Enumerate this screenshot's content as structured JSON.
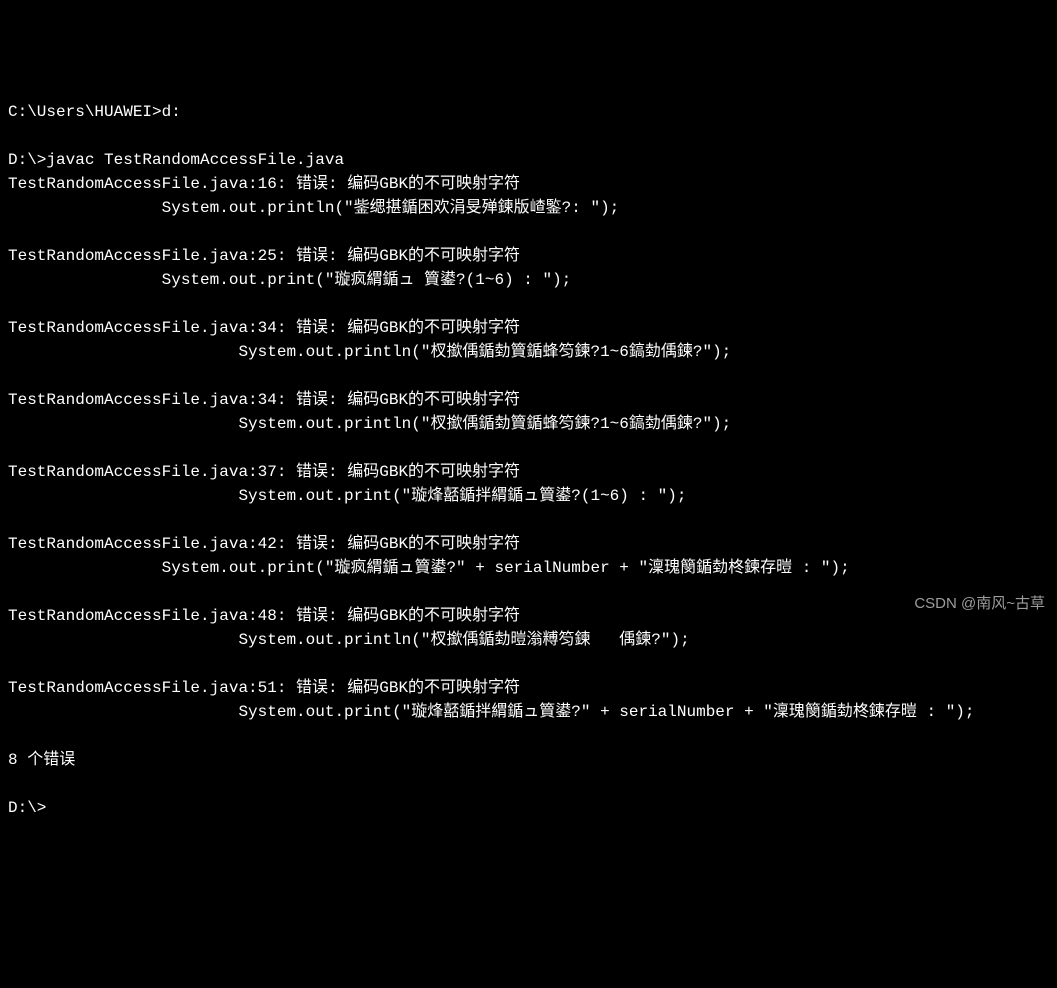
{
  "terminal": {
    "lines": [
      "C:\\Users\\HUAWEI>d:",
      "",
      "D:\\>javac TestRandomAccessFile.java",
      "TestRandomAccessFile.java:16: 错误: 编码GBK的不可映射字符",
      "                System.out.println(\"鈭缌揕鍎困欢涓旻殚鍊版嵖鍳?: \");",
      "",
      "TestRandomAccessFile.java:25: 错误: 编码GBK的不可映射字符",
      "                System.out.print(\"璇疯緭鍎ュ 簤鍙?(1~6) : \");",
      "",
      "TestRandomAccessFile.java:34: 错误: 编码GBK的不可映射字符",
      "                        System.out.println(\"杈撳偊鍎勎簤鍎蜂笉鍊?1~6鎬勎偊鍊?\");",
      "",
      "TestRandomAccessFile.java:34: 错误: 编码GBK的不可映射字符",
      "                        System.out.println(\"杈撳偊鍎勎簤鍎蜂笉鍊?1~6鎬勎偊鍊?\");",
      "",
      "TestRandomAccessFile.java:37: 错误: 编码GBK的不可映射字符",
      "                        System.out.print(\"璇烽嚭鍎拌緭鍎ュ簤鍙?(1~6) : \");",
      "",
      "TestRandomAccessFile.java:42: 错误: 编码GBK的不可映射字符",
      "                System.out.print(\"璇疯緭鍎ュ簤鍙?\" + serialNumber + \"澟瑰簢鍎勎柊鍊存暟 : \");",
      "",
      "TestRandomAccessFile.java:48: 错误: 编码GBK的不可映射字符",
      "                        System.out.println(\"杈撳偊鍎勎暟滃糐笉鍊   偊鍊?\");",
      "",
      "TestRandomAccessFile.java:51: 错误: 编码GBK的不可映射字符",
      "                        System.out.print(\"璇烽嚭鍎拌緭鍎ュ簤鍙?\" + serialNumber + \"澟瑰簢鍎勎柊鍊存暟 : \");",
      "",
      "8 个错误",
      "",
      "D:\\>"
    ]
  },
  "watermark": "CSDN @南风~古草"
}
